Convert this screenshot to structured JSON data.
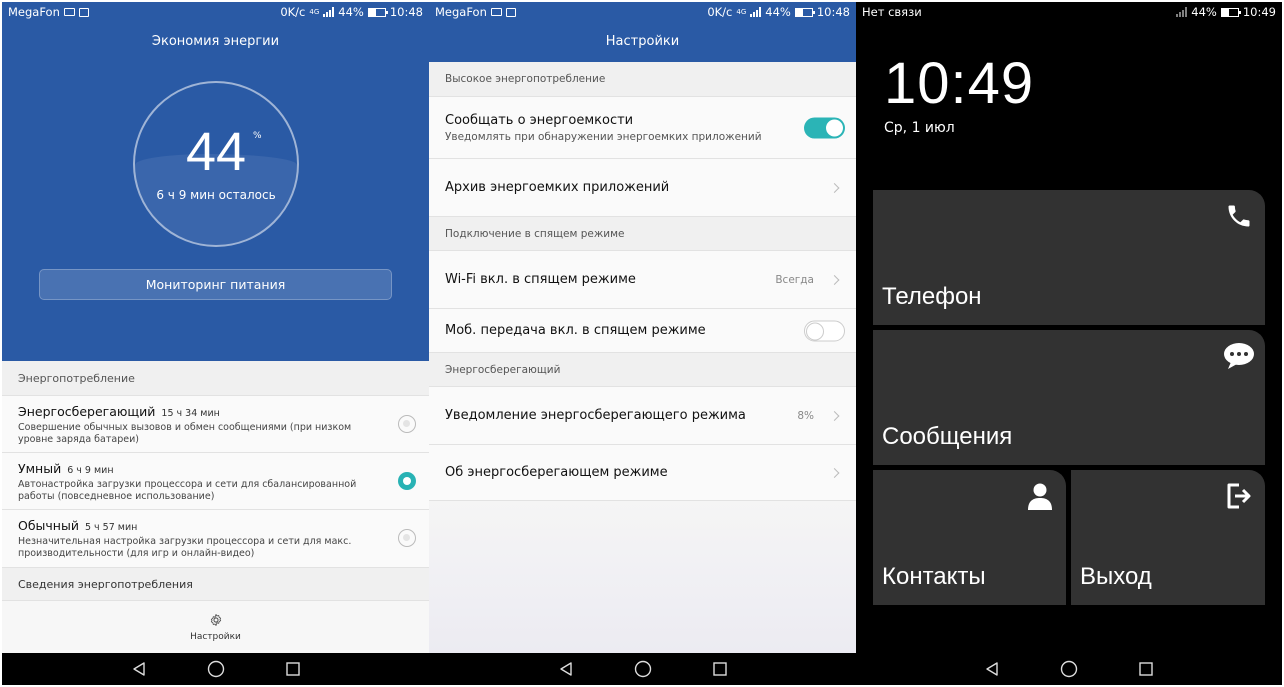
{
  "panel1": {
    "status": {
      "carrier": "MegaFon",
      "speed": "0K/с",
      "net": "4G",
      "battery": "44%",
      "time": "10:48"
    },
    "title": "Экономия энергии",
    "battery_percent": "44",
    "percent_sign": "%",
    "remaining": "6 ч 9 мин осталось",
    "monitor_button": "Мониторинг питания",
    "section_power": "Энергопотребление",
    "modes": [
      {
        "name": "Энергосберегающий",
        "time": "15 ч 34 мин",
        "desc": "Совершение обычных вызовов и обмен сообщениями (при низком уровне заряда батареи)",
        "selected": false
      },
      {
        "name": "Умный",
        "time": "6 ч 9 мин",
        "desc": "Автонастройка загрузки процессора и сети для сбалансированной работы (повседневное использование)",
        "selected": true
      },
      {
        "name": "Обычный",
        "time": "5 ч 57 мин",
        "desc": "Незначительная настройка загрузки процессора и сети для макс. производительности (для игр и онлайн-видео)",
        "selected": false
      }
    ],
    "section_details": "Сведения энергопотребления",
    "settings_label": "Настройки"
  },
  "panel2": {
    "status": {
      "carrier": "MegaFon",
      "speed": "0K/с",
      "net": "4G",
      "battery": "44%",
      "time": "10:48"
    },
    "title": "Настройки",
    "h_high": "Высокое энергопотребление",
    "notify_title": "Сообщать о энергоемкости",
    "notify_sub": "Уведомлять при обнаружении энергоемких приложений",
    "notify_on": true,
    "archive": "Архив энергоемких приложений",
    "h_sleep": "Подключение в спящем режиме",
    "wifi_sleep": "Wi-Fi вкл. в спящем режиме",
    "wifi_value": "Всегда",
    "mobile_sleep": "Моб. передача вкл. в спящем режиме",
    "mobile_on": false,
    "h_saving": "Энергосберегающий",
    "saving_notify": "Уведомление энергосберегающего режима",
    "saving_value": "8%",
    "about_saving": "Об энергосберегающем режиме"
  },
  "panel3": {
    "status": {
      "carrier": "Нет связи",
      "battery": "44%",
      "time": "10:49"
    },
    "clock": "10:49",
    "date": "Ср, 1 июл",
    "tiles": {
      "phone": "Телефон",
      "messages": "Сообщения",
      "contacts": "Контакты",
      "exit": "Выход"
    }
  },
  "colors": {
    "header_blue": "#2a5aa5",
    "accent_teal": "#28b2b4",
    "tile_gray": "#323232"
  },
  "icons": [
    "back-icon",
    "home-icon",
    "recents-icon",
    "gear-icon",
    "phone-icon",
    "chat-icon",
    "person-icon",
    "exit-icon",
    "chevron-right-icon"
  ]
}
